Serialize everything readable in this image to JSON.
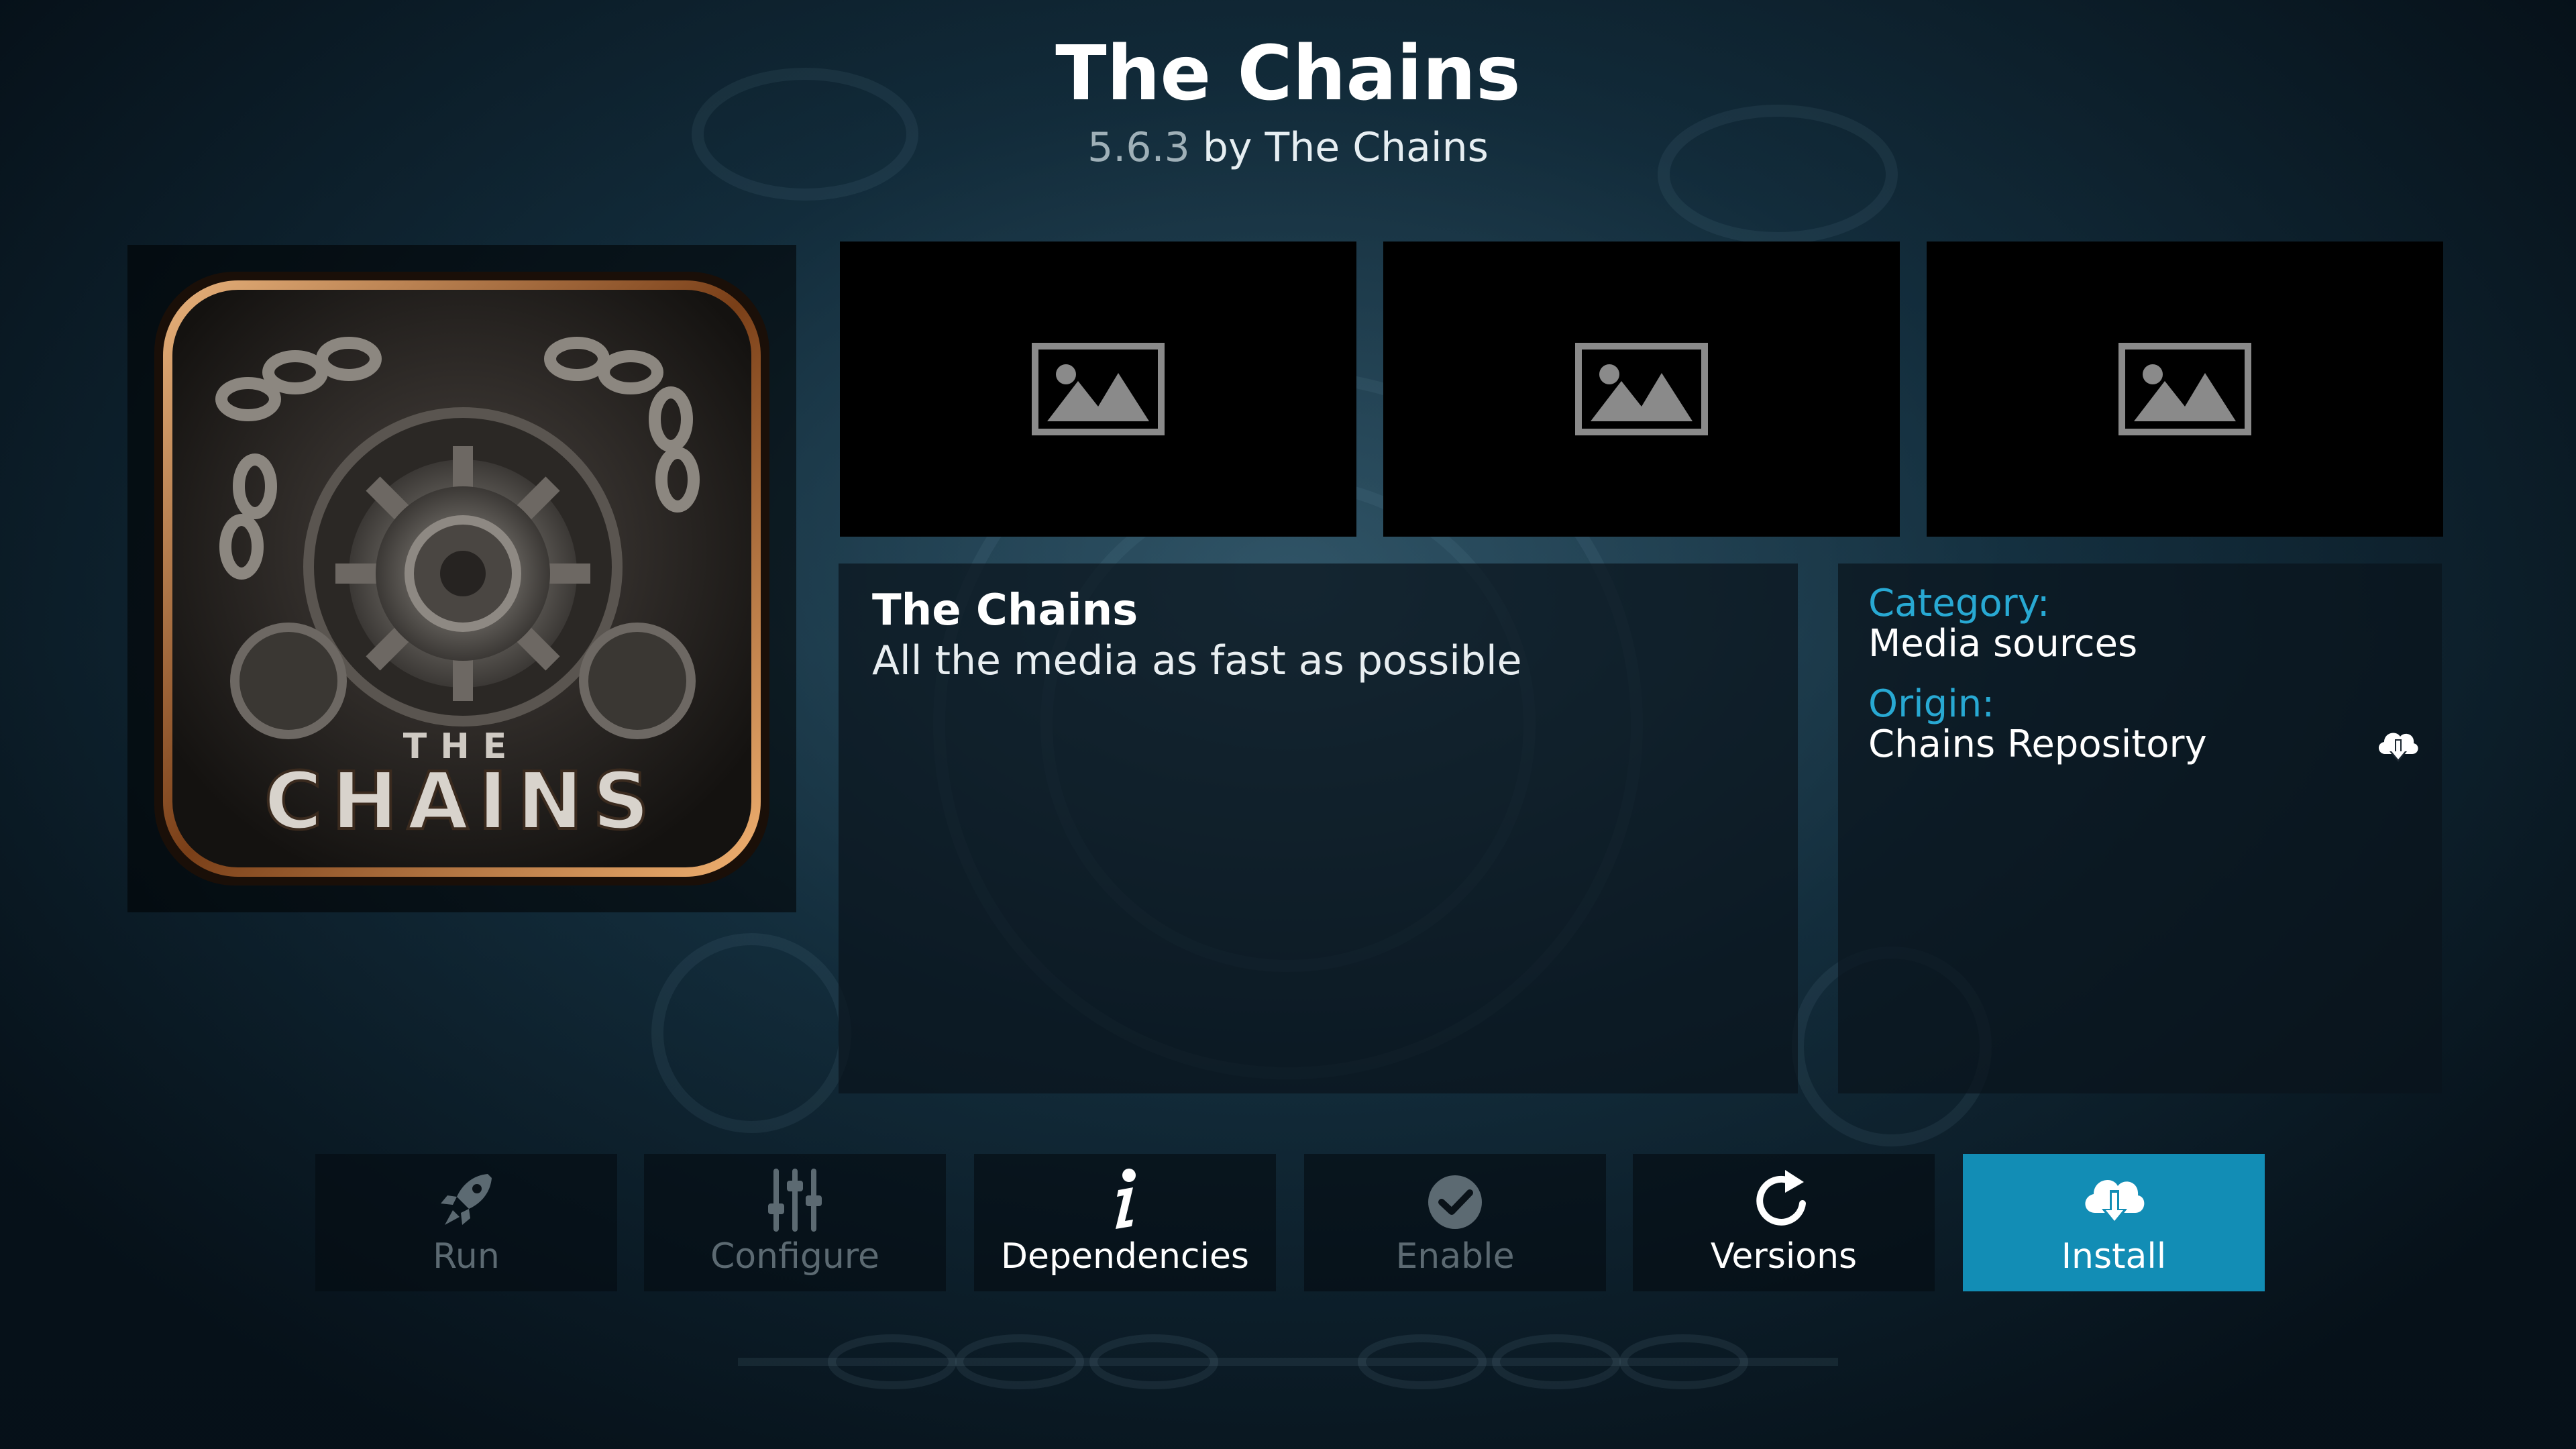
{
  "header": {
    "title": "The Chains",
    "version": "5.6.3",
    "author_text": "by The Chains"
  },
  "addon_icon": {
    "logo_top_text": "THE",
    "logo_main_text": "CHAINS"
  },
  "screenshots": [
    {
      "icon": "image-placeholder-icon"
    },
    {
      "icon": "image-placeholder-icon"
    },
    {
      "icon": "image-placeholder-icon"
    }
  ],
  "description": {
    "name": "The Chains",
    "summary": "All the media as fast as possible"
  },
  "info": {
    "category_label": "Category:",
    "category_value": "Media sources",
    "origin_label": "Origin:",
    "origin_value": "Chains Repository",
    "origin_icon": "cloud-download-icon"
  },
  "actions": [
    {
      "label": "Run",
      "icon": "rocket-icon",
      "state": "disabled"
    },
    {
      "label": "Configure",
      "icon": "sliders-icon",
      "state": "disabled"
    },
    {
      "label": "Dependencies",
      "icon": "info-icon",
      "state": "enabled"
    },
    {
      "label": "Enable",
      "icon": "checkmark-icon",
      "state": "disabled"
    },
    {
      "label": "Versions",
      "icon": "refresh-icon",
      "state": "enabled"
    },
    {
      "label": "Install",
      "icon": "cloud-download-icon",
      "state": "focused"
    }
  ],
  "colors": {
    "accent": "#128db5",
    "label_blue": "#28a9d3",
    "disabled_text": "#5c6a72"
  }
}
